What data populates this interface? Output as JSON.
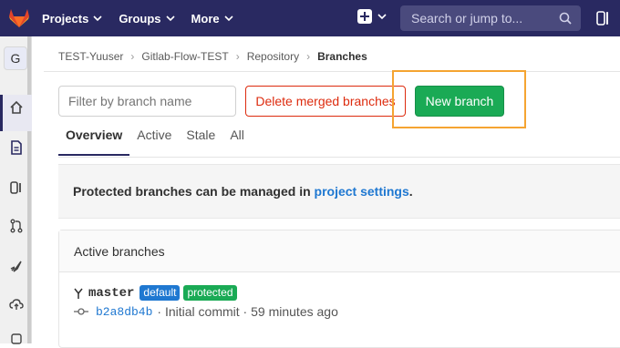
{
  "topbar": {
    "nav": [
      {
        "label": "Projects"
      },
      {
        "label": "Groups"
      },
      {
        "label": "More"
      }
    ],
    "search_placeholder": "Search or jump to..."
  },
  "sidebar": {
    "project_initial": "G"
  },
  "breadcrumb": [
    "TEST-Yuuser",
    "Gitlab-Flow-TEST",
    "Repository",
    "Branches"
  ],
  "toolbar": {
    "filter_placeholder": "Filter by branch name",
    "delete_merged_label": "Delete merged branches",
    "new_branch_label": "New branch"
  },
  "tabs": [
    {
      "label": "Overview",
      "active": true
    },
    {
      "label": "Active"
    },
    {
      "label": "Stale"
    },
    {
      "label": "All"
    }
  ],
  "notice": {
    "prefix": "Protected branches can be managed in ",
    "link": "project settings",
    "suffix": "."
  },
  "active_branches": {
    "title": "Active branches",
    "branches": [
      {
        "name": "master",
        "badges": [
          "default",
          "protected"
        ],
        "sha": "b2a8db4b",
        "message": "Initial commit",
        "time": "59 minutes ago"
      }
    ]
  },
  "colors": {
    "nav_bg": "#292961",
    "new_branch_bg": "#1aaa55",
    "delete_btn": "#dd2b0e",
    "link": "#1f78d1",
    "highlight": "#f5a431"
  }
}
